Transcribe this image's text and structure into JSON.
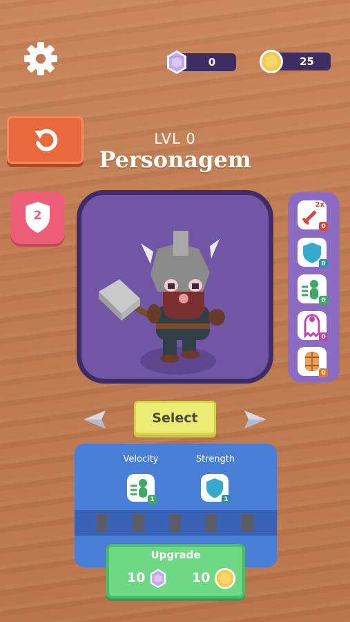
{
  "hud": {
    "gems": "0",
    "coins": "25"
  },
  "header": {
    "level": "LVL 0",
    "title": "Personagem"
  },
  "armor_badge": {
    "value": "2"
  },
  "powerups": [
    {
      "name": "double-damage",
      "badge": "2x",
      "count": "0",
      "color": "#e0453d"
    },
    {
      "name": "shield",
      "count": "0",
      "color": "#2f8fb0"
    },
    {
      "name": "speed",
      "count": "0",
      "color": "#3da868"
    },
    {
      "name": "ghost",
      "count": "0",
      "color": "#c245a8"
    },
    {
      "name": "barrel",
      "count": "0",
      "color": "#e07a2a"
    }
  ],
  "select": {
    "label": "Select"
  },
  "stats": {
    "velocity_label": "Velocity",
    "strength_label": "Strength",
    "velocity_level": "1",
    "strength_level": "1",
    "pips_filled": 0,
    "pips_total": 5
  },
  "upgrade": {
    "label": "Upgrade",
    "gem_cost": "10",
    "coin_cost": "10"
  },
  "colors": {
    "gem": "#c7a6f0",
    "coin": "#f5c94a",
    "panel_purple": "#7056a4",
    "panel_blue": "#4a7fd8"
  }
}
